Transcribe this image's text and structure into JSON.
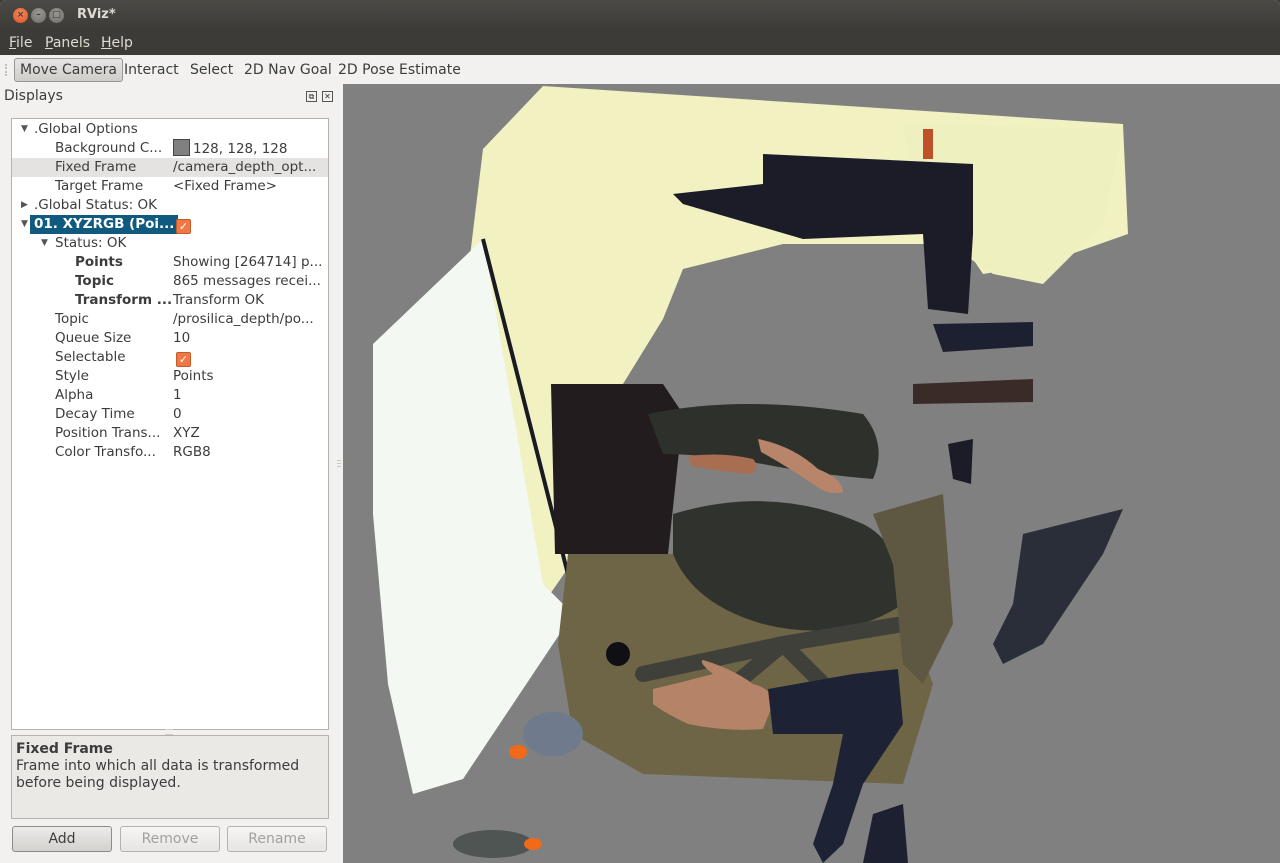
{
  "window": {
    "title": "RViz*",
    "controls": [
      "close",
      "minimize",
      "maximize"
    ]
  },
  "menubar": {
    "items": [
      {
        "label": "File",
        "mnemonic": "F",
        "rest": "ile"
      },
      {
        "label": "Panels",
        "mnemonic": "P",
        "rest": "anels"
      },
      {
        "label": "Help",
        "mnemonic": "H",
        "rest": "elp"
      }
    ]
  },
  "toolbar": {
    "tools": [
      {
        "label": "Move Camera",
        "active": true
      },
      {
        "label": "Interact",
        "active": false
      },
      {
        "label": "Select",
        "active": false
      },
      {
        "label": "2D Nav Goal",
        "active": false
      },
      {
        "label": "2D Pose Estimate",
        "active": false
      }
    ]
  },
  "displays": {
    "title": "Displays",
    "tree": [
      {
        "label": ".Global Options",
        "expanded": true
      },
      {
        "label": "Background C...",
        "value": "128, 128, 128",
        "swatch": "#808080"
      },
      {
        "label": "Fixed Frame",
        "value": "/camera_depth_opt...",
        "highlighted": true
      },
      {
        "label": "Target Frame",
        "value": "<Fixed Frame>"
      },
      {
        "label": ".Global Status: OK",
        "expanded": false
      },
      {
        "label": "01. XYZRGB (Poi...",
        "checked": true,
        "selected": true,
        "expanded": true
      },
      {
        "label": "Status: OK",
        "expanded": true
      },
      {
        "label": "Points",
        "value": "Showing [264714] p..."
      },
      {
        "label": "Topic",
        "value": "865 messages recei..."
      },
      {
        "label": "Transform ...",
        "value": "Transform OK"
      },
      {
        "label": "Topic",
        "value": "/prosilica_depth/po..."
      },
      {
        "label": "Queue Size",
        "value": "10"
      },
      {
        "label": "Selectable",
        "checked": true
      },
      {
        "label": "Style",
        "value": "Points"
      },
      {
        "label": "Alpha",
        "value": "1"
      },
      {
        "label": "Decay Time",
        "value": "0"
      },
      {
        "label": "Position Trans...",
        "value": "XYZ"
      },
      {
        "label": "Color Transfo...",
        "value": "RGB8"
      }
    ],
    "help": {
      "title": "Fixed Frame",
      "body": "Frame into which all data is transformed before being displayed."
    },
    "buttons": {
      "add": "Add",
      "remove": "Remove",
      "rename": "Rename"
    }
  },
  "view3d": {
    "background": "#808080",
    "content": "XYZRGB point cloud of an office cubicle with a chair, a whiteboard and an outstretched hand",
    "colors": {
      "wall": "#f2f2c4",
      "whiteboard": "#f4f8f2",
      "dark": "#1d1d2a",
      "floor": "#6f6648",
      "chair": "#2e302c",
      "skin": "#b98566",
      "sleeve": "#1e2438",
      "orange_light": "#f06a1a"
    }
  }
}
